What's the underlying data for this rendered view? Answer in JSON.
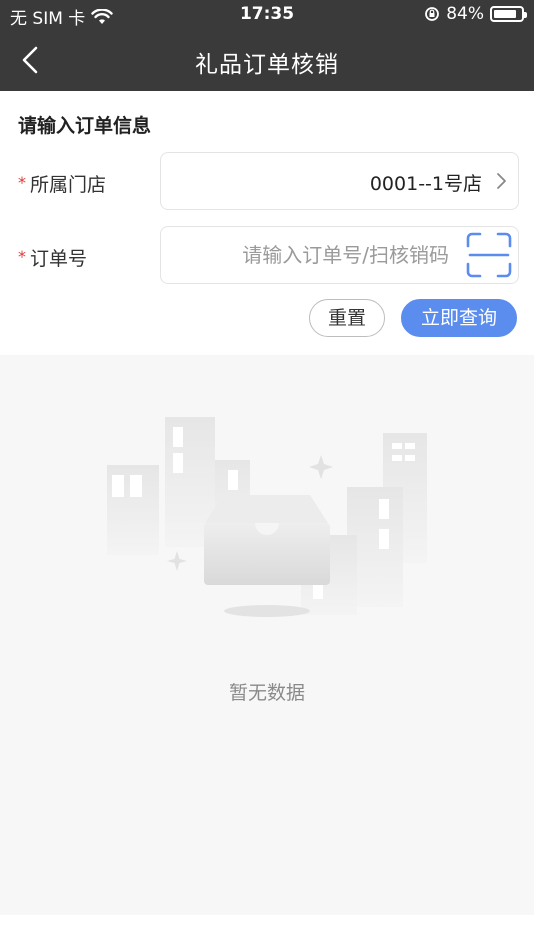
{
  "status_bar": {
    "carrier": "无 SIM 卡",
    "time": "17:35",
    "battery_percent": "84%",
    "battery_level": 0.84
  },
  "navbar": {
    "title": "礼品订单核销",
    "back_icon": "chevron-left-icon"
  },
  "form": {
    "section_title": "请输入订单信息",
    "required_mark": "*",
    "store": {
      "label": "所属门店",
      "value": "0001--1号店",
      "icon": "chevron-right-icon"
    },
    "order": {
      "label": "订单号",
      "value": "",
      "placeholder": "请输入订单号/扫核销码",
      "scan_icon": "scan-icon"
    },
    "buttons": {
      "reset": "重置",
      "query": "立即查询"
    }
  },
  "empty_state": {
    "text": "暂无数据",
    "illustration_icon": "empty-box-icon"
  },
  "colors": {
    "header_bg": "#3a3a3a",
    "accent": "#5b8def",
    "required": "#e53935",
    "empty_bg": "#f7f7f7"
  }
}
